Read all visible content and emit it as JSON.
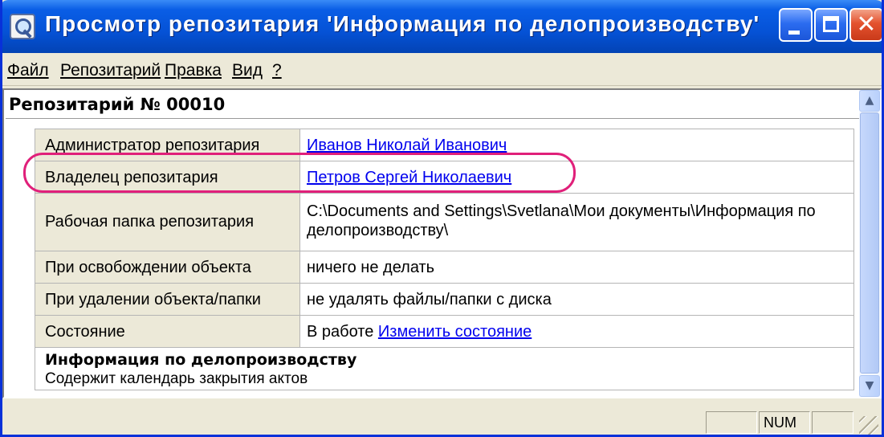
{
  "window": {
    "title": "Просмотр репозитария 'Информация по делопроизводству'"
  },
  "menu": {
    "items": [
      {
        "label": "Файл"
      },
      {
        "label": "Репозитарий"
      },
      {
        "label": "Правка"
      },
      {
        "label": "Вид"
      },
      {
        "label": "?"
      }
    ]
  },
  "repository": {
    "header": "Репозитарий № 00010",
    "properties": [
      {
        "label": "Администратор репозитария",
        "value": "Иванов Николай Иванович",
        "is_link": true
      },
      {
        "label": "Владелец репозитария",
        "value": "Петров Сергей Николаевич",
        "is_link": true
      },
      {
        "label": "Рабочая папка репозитария",
        "value": "C:\\Documents and Settings\\Svetlana\\Мои документы\\Информация по делопроизводству\\",
        "is_link": false
      },
      {
        "label": "При освобождении объекта",
        "value": "ничего не делать",
        "is_link": false
      },
      {
        "label": "При удалении объекта/папки",
        "value": "не удалять файлы/папки с диска",
        "is_link": false
      },
      {
        "label": "Состояние",
        "value": "В работе",
        "action_link": "Изменить состояние"
      }
    ],
    "description_title": "Информация по делопроизводству",
    "description_text": "Содержит календарь закрытия актов"
  },
  "statusbar": {
    "num_indicator": "NUM"
  },
  "colors": {
    "titlebar": "#0552d6",
    "link": "#0000ee",
    "highlight": "#e0207a",
    "chrome": "#ece9d8"
  }
}
